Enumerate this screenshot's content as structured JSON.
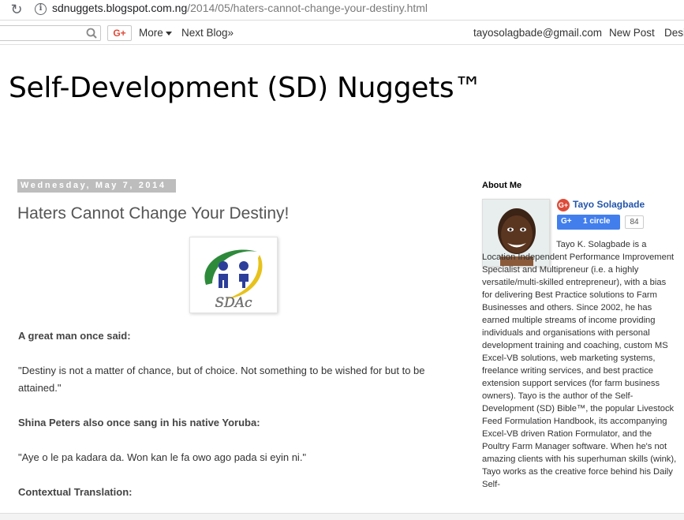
{
  "browser": {
    "url_host": "sdnuggets.blogspot.com.ng",
    "url_path": "/2014/05/haters-cannot-change-your-destiny.html"
  },
  "navbar": {
    "gplus_label": "G+",
    "more_label": "More",
    "next_blog_label": "Next Blog»",
    "account_email": "tayosolagbade@gmail.com",
    "new_post_label": "New Post",
    "design_label": "Desi"
  },
  "blog": {
    "title": "Self-Development (SD) Nuggets™"
  },
  "post": {
    "date_header": "Wednesday, May 7, 2014",
    "title": "Haters Cannot Change Your Destiny!",
    "image_logo_text": "SDAc",
    "paragraphs": [
      "A great man once said:",
      "\"Destiny is not a matter of chance, but of choice. Not something to be wished for but to be attained.\"",
      "Shina Peters also once sang in his native Yoruba:",
      "\"Aye o le pa kadara da. Won kan le fa owo ago pada si eyin ni.\"",
      "Contextual Translation:"
    ]
  },
  "sidebar": {
    "about_heading": "About Me",
    "profile_name": "Tayo Solagbade",
    "gplus_badge": "G+",
    "circle_label": "1 circle",
    "circle_count": "84",
    "about_text": "Tayo K. Solagbade is a Location Independent Performance Improvement Specialist and Multipreneur (i.e. a highly versatile/multi-skilled entrepreneur), with a bias for delivering Best Practice solutions to Farm Businesses and others. Since 2002, he has earned multiple streams of income providing individuals and organisations with personal development training and coaching, custom MS Excel-VB solutions, web marketing systems, freelance writing services, and best practice extension support services (for farm business owners). Tayo is the author of the Self-Development (SD) Bible™, the popular Livestock Feed Formulation Handbook, its accompanying Excel-VB driven Ration Formulator, and the Poultry Farm Manager software.  When he's not amazing clients with his superhuman skills (wink), Tayo works as the creative force behind his Daily Self-"
  },
  "colors": {
    "accent_link": "#2255aa",
    "gplus_red": "#dd4b39",
    "circle_blue": "#427fed",
    "date_bg": "#bdbdbd"
  }
}
